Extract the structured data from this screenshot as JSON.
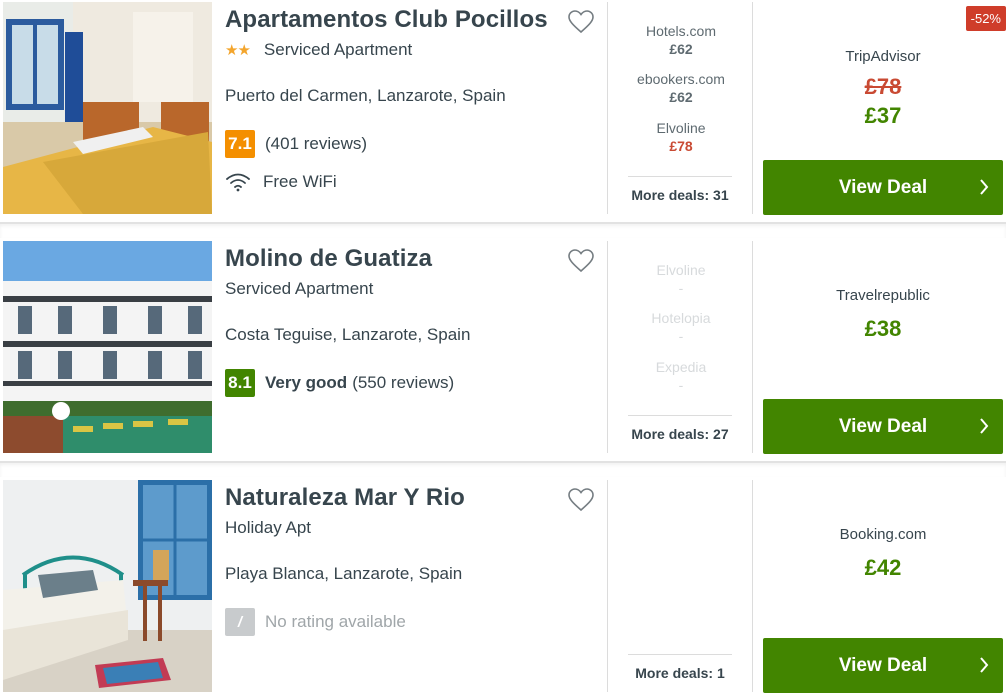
{
  "hotels": [
    {
      "name": "Apartamentos Club Pocillos",
      "stars": "★★",
      "type": "Serviced Apartment",
      "location": "Puerto del Carmen, Lanzarote, Spain",
      "rating_score": "7.1",
      "rating_color": "#f48f00",
      "rating_word": "",
      "reviews": "(401 reviews)",
      "amenity": "Free WiFi",
      "deals": [
        {
          "site": "Hotels.com",
          "price": "£62"
        },
        {
          "site": "ebookers.com",
          "price": "£62"
        },
        {
          "site": "Elvoline",
          "price": "£78"
        }
      ],
      "more_deals": "More deals: 31",
      "discount": "-52%",
      "best_provider": "TripAdvisor",
      "old_price": "£78",
      "price": "£37",
      "cta": "View Deal"
    },
    {
      "name": "Molino de Guatiza",
      "stars": "",
      "type": "Serviced Apartment",
      "location": "Costa Teguise, Lanzarote, Spain",
      "rating_score": "8.1",
      "rating_color": "#428500",
      "rating_word": "Very good",
      "reviews": "(550 reviews)",
      "amenity": "",
      "deals": [
        {
          "site": "Elvoline",
          "price": "-"
        },
        {
          "site": "Hotelopia",
          "price": "-"
        },
        {
          "site": "Expedia",
          "price": "-"
        }
      ],
      "more_deals": "More deals: 27",
      "discount": "",
      "best_provider": "Travelrepublic",
      "old_price": "",
      "price": "£38",
      "cta": "View Deal"
    },
    {
      "name": "Naturaleza Mar Y Rio",
      "stars": "",
      "type": "Holiday Apt",
      "location": "Playa Blanca, Lanzarote, Spain",
      "rating_score": "/",
      "rating_color": "#c8cbcd",
      "rating_word": "",
      "reviews": "No rating available",
      "amenity": "",
      "deals": [],
      "more_deals": "More deals: 1",
      "discount": "",
      "best_provider": "Booking.com",
      "old_price": "",
      "price": "£42",
      "cta": "View Deal"
    }
  ],
  "colors": {
    "accent_green": "#428500",
    "discount_red": "#cf3d2a",
    "star_orange": "#f3a52d"
  }
}
